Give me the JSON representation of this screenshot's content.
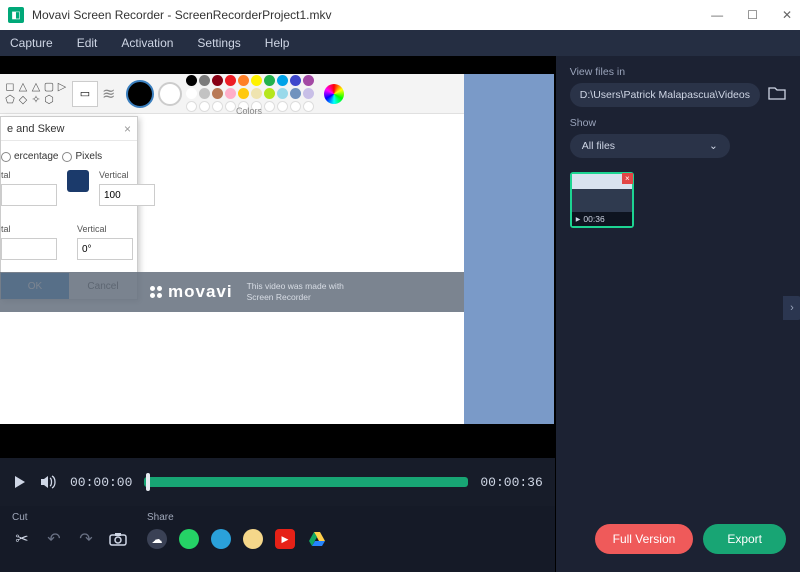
{
  "titlebar": {
    "app": "Movavi Screen Recorder",
    "file": "ScreenRecorderProject1.mkv"
  },
  "menu": {
    "capture": "Capture",
    "edit": "Edit",
    "activation": "Activation",
    "settings": "Settings",
    "help": "Help"
  },
  "paint": {
    "colors_label": "Colors"
  },
  "dialog": {
    "title": "e and Skew",
    "unit_percent": "ercentage",
    "unit_pixels": "Pixels",
    "htal1": "tal",
    "vertical": "Vertical",
    "v1": "100",
    "htal2": "tal",
    "v2": "0°",
    "ok": "OK",
    "cancel": "Cancel"
  },
  "watermark": {
    "brand": "movavi",
    "line1": "This video was made with",
    "line2": "Screen Recorder"
  },
  "playback": {
    "current": "00:00:00",
    "total": "00:00:36"
  },
  "bottom": {
    "cut": "Cut",
    "share": "Share"
  },
  "right": {
    "view_label": "View files in",
    "path": "D:\\Users\\Patrick Malapascua\\Videos",
    "show_label": "Show",
    "filter": "All files",
    "thumb_time": "00:36",
    "full_version": "Full Version",
    "export": "Export"
  },
  "colors": {
    "row1": [
      "#000",
      "#7a7a7a",
      "#870014",
      "#ed1c24",
      "#ff7f27",
      "#fff200",
      "#22b14c",
      "#00a2e8",
      "#3f48cc",
      "#a349a4"
    ],
    "row2": [
      "#fff",
      "#c3c3c3",
      "#b97a57",
      "#ffaec9",
      "#ffc90e",
      "#efe4b0",
      "#b5e61d",
      "#99d9ea",
      "#7092be",
      "#c8bfe7"
    ]
  }
}
